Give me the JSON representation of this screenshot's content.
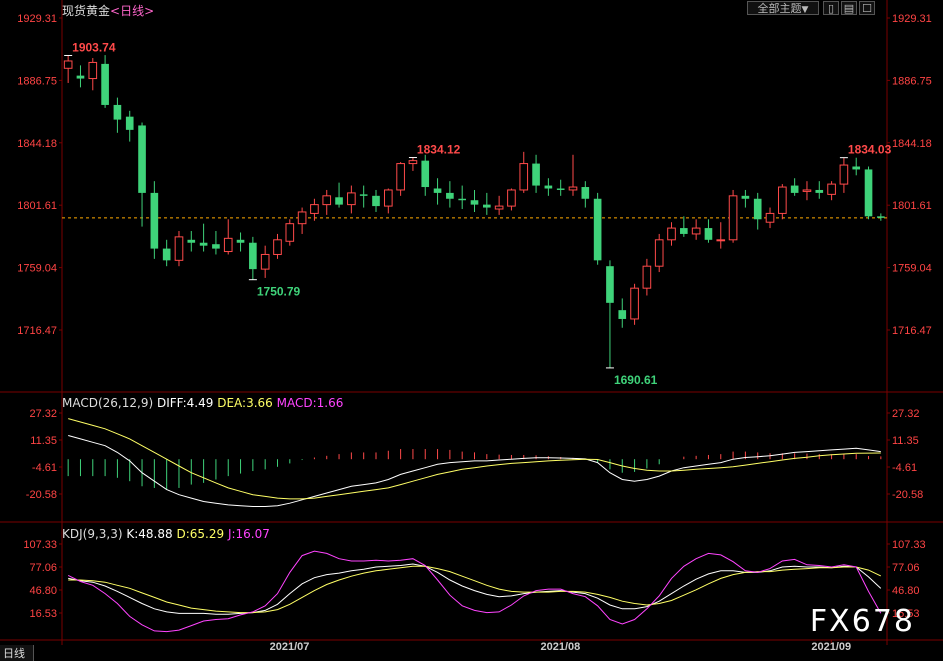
{
  "header": {
    "instrument": "现货黄金",
    "period_open": "<",
    "period": "日线",
    "period_close": ">"
  },
  "toolbar": {
    "theme_select": "全部主题",
    "theme_arrow": "▼",
    "btn1": "▯",
    "btn2": "▤",
    "btn3": "☐"
  },
  "macd": {
    "label": "MACD(26,12,9)",
    "diff": "DIFF:4.49",
    "dea": "DEA:3.66",
    "macd": "MACD:1.66"
  },
  "kdj": {
    "label": "KDJ(9,3,3)",
    "k": "K:48.88",
    "d": "D:65.29",
    "j": "J:16.07"
  },
  "bottom_tab": "日线",
  "watermark": "FX678",
  "colors": {
    "up": "#ff4a4a",
    "down": "#3fd37a",
    "diff": "#ffffff",
    "dea": "#ffff66",
    "macd_label": "#ff44ff",
    "j": "#ff44ff",
    "axis_text": "#ff4444",
    "grid": "#3a0000"
  },
  "chart_data": [
    {
      "type": "candlestick",
      "title": "现货黄金",
      "y_ticks": [
        "1929.31",
        "1886.75",
        "1844.18",
        "1801.61",
        "1759.04",
        "1716.47"
      ],
      "x_ticks": [
        "2021/07",
        "2021/08",
        "2021/09"
      ],
      "ylim": [
        1673.86,
        1929.31
      ],
      "current_price": 1793,
      "annotations": [
        {
          "text": "1903.74",
          "index": 0,
          "value": 1903.74
        },
        {
          "text": "1834.12",
          "index": 28,
          "value": 1834.12
        },
        {
          "text": "1750.79",
          "index": 15,
          "value": 1750.79
        },
        {
          "text": "1690.61",
          "index": 44,
          "value": 1690.61
        },
        {
          "text": "1834.03",
          "index": 63,
          "value": 1834.03
        }
      ],
      "ohlc": [
        [
          1895,
          1903.74,
          1885,
          1900
        ],
        [
          1890,
          1897,
          1882,
          1888
        ],
        [
          1888,
          1902,
          1880,
          1899
        ],
        [
          1898,
          1904,
          1868,
          1870
        ],
        [
          1870,
          1875,
          1851,
          1860
        ],
        [
          1862,
          1866,
          1845,
          1853
        ],
        [
          1856,
          1858,
          1787,
          1810
        ],
        [
          1810,
          1818,
          1765,
          1772
        ],
        [
          1772,
          1778,
          1760,
          1764
        ],
        [
          1764,
          1784,
          1760,
          1780
        ],
        [
          1778,
          1784,
          1770,
          1776
        ],
        [
          1776,
          1789,
          1770,
          1774
        ],
        [
          1775,
          1784,
          1768,
          1772
        ],
        [
          1770,
          1792,
          1768,
          1779
        ],
        [
          1778,
          1783,
          1770,
          1776
        ],
        [
          1776,
          1780,
          1750.79,
          1758
        ],
        [
          1758,
          1774,
          1752,
          1768
        ],
        [
          1768,
          1782,
          1765,
          1778
        ],
        [
          1777,
          1792,
          1774,
          1789
        ],
        [
          1789,
          1800,
          1782,
          1797
        ],
        [
          1796,
          1806,
          1791,
          1802
        ],
        [
          1802,
          1812,
          1795,
          1808
        ],
        [
          1807,
          1817,
          1800,
          1802
        ],
        [
          1802,
          1815,
          1796,
          1810
        ],
        [
          1809,
          1815,
          1800,
          1808
        ],
        [
          1808,
          1812,
          1797,
          1801
        ],
        [
          1801,
          1813,
          1796,
          1812
        ],
        [
          1812,
          1831,
          1808,
          1830
        ],
        [
          1830,
          1834.12,
          1825,
          1832
        ],
        [
          1832,
          1836,
          1808,
          1814
        ],
        [
          1813,
          1820,
          1802,
          1810
        ],
        [
          1810,
          1818,
          1800,
          1806
        ],
        [
          1806,
          1815,
          1799,
          1805
        ],
        [
          1805,
          1812,
          1797,
          1802
        ],
        [
          1802,
          1810,
          1795,
          1800
        ],
        [
          1799,
          1808,
          1795,
          1801
        ],
        [
          1801,
          1813,
          1798,
          1812
        ],
        [
          1812,
          1838,
          1810,
          1830
        ],
        [
          1830,
          1836,
          1810,
          1815
        ],
        [
          1815,
          1820,
          1808,
          1813
        ],
        [
          1813,
          1819,
          1808,
          1812
        ],
        [
          1812,
          1836,
          1808,
          1814
        ],
        [
          1814,
          1818,
          1800,
          1806
        ],
        [
          1806,
          1810,
          1761,
          1764
        ],
        [
          1760,
          1764,
          1690.61,
          1735
        ],
        [
          1730,
          1738,
          1718,
          1724
        ],
        [
          1724,
          1748,
          1720,
          1745
        ],
        [
          1745,
          1765,
          1740,
          1760
        ],
        [
          1760,
          1782,
          1756,
          1778
        ],
        [
          1778,
          1790,
          1774,
          1786
        ],
        [
          1786,
          1794,
          1780,
          1782
        ],
        [
          1782,
          1792,
          1778,
          1786
        ],
        [
          1786,
          1792,
          1776,
          1778
        ],
        [
          1778,
          1790,
          1772,
          1778
        ],
        [
          1778,
          1812,
          1776,
          1808
        ],
        [
          1808,
          1812,
          1800,
          1806
        ],
        [
          1806,
          1810,
          1785,
          1792
        ],
        [
          1790,
          1800,
          1786,
          1796
        ],
        [
          1796,
          1816,
          1792,
          1814
        ],
        [
          1815,
          1820,
          1808,
          1810
        ],
        [
          1811,
          1818,
          1805,
          1812
        ],
        [
          1812,
          1818,
          1806,
          1810
        ],
        [
          1809,
          1818,
          1805,
          1816
        ],
        [
          1816,
          1834.03,
          1810,
          1829
        ],
        [
          1828,
          1834,
          1822,
          1826
        ],
        [
          1826,
          1828,
          1792,
          1794
        ],
        [
          1794,
          1796,
          1791,
          1793
        ]
      ]
    },
    {
      "type": "line",
      "title": "MACD(26,12,9)",
      "y_ticks": [
        "27.32",
        "11.35",
        "-4.61",
        "-20.58"
      ],
      "ylim": [
        -36.55,
        35.3
      ],
      "series": [
        {
          "name": "DIFF",
          "values": [
            14,
            12,
            10,
            8,
            4,
            -1,
            -8,
            -13,
            -18,
            -21,
            -23,
            -25,
            -26,
            -27,
            -27.5,
            -28,
            -28,
            -27.5,
            -26,
            -24,
            -22,
            -20,
            -18,
            -16,
            -15,
            -14,
            -12,
            -9,
            -7,
            -5,
            -3,
            -2,
            -1.5,
            -1,
            -1,
            -0.5,
            0,
            0.5,
            0.8,
            0.8,
            0.7,
            0.5,
            0.2,
            -2,
            -8,
            -12,
            -13,
            -12,
            -10,
            -7,
            -5,
            -4,
            -3,
            -2,
            0,
            1,
            1.5,
            2,
            3,
            4,
            4.5,
            5,
            5.5,
            6,
            6.5,
            5.5,
            4.49
          ]
        },
        {
          "name": "DEA",
          "values": [
            24,
            22,
            20,
            18,
            15,
            12,
            8,
            4,
            0,
            -4,
            -8,
            -11,
            -14,
            -17,
            -19,
            -21,
            -22,
            -23,
            -23.5,
            -23.5,
            -23,
            -22,
            -21,
            -20,
            -19,
            -18,
            -17,
            -15,
            -13,
            -11,
            -9,
            -7.5,
            -6,
            -5,
            -4,
            -3.2,
            -2.5,
            -2,
            -1.5,
            -1,
            -0.6,
            -0.3,
            0,
            -0.2,
            -2,
            -4,
            -5.5,
            -6.5,
            -7,
            -7,
            -6.5,
            -6,
            -5.5,
            -5,
            -4.5,
            -3.5,
            -2.5,
            -1.5,
            -0.5,
            0.5,
            1.2,
            2,
            2.6,
            3.1,
            3.5,
            3.6,
            3.66
          ]
        },
        {
          "name": "MACD",
          "values": [
            -10,
            -10,
            -10,
            -10,
            -11,
            -13,
            -16,
            -17,
            -18,
            -17,
            -15,
            -14,
            -12,
            -10,
            -8.5,
            -7,
            -6,
            -4.5,
            -2.5,
            -0.5,
            1,
            2,
            3,
            4,
            4,
            4,
            5,
            6,
            6,
            6,
            6,
            5.5,
            4.5,
            4,
            3,
            2.7,
            2.5,
            2.5,
            2.3,
            1.8,
            1.3,
            0.8,
            0.2,
            -1.8,
            -6,
            -8,
            -7.5,
            -5.5,
            -3,
            0,
            1.5,
            2,
            2.5,
            3,
            4.5,
            4.5,
            4,
            3.5,
            3.5,
            3.5,
            3.3,
            3,
            2.9,
            2.9,
            3,
            1.9,
            1.66
          ]
        }
      ]
    },
    {
      "type": "line",
      "title": "KDJ(9,3,3)",
      "y_ticks": [
        "107.33",
        "77.06",
        "46.80",
        "16.53"
      ],
      "ylim": [
        -6.5,
        114.8
      ],
      "series": [
        {
          "name": "K",
          "values": [
            62,
            59,
            57,
            52,
            45,
            37,
            29,
            22,
            18,
            16,
            16,
            16,
            15,
            15,
            16,
            17,
            20,
            28,
            42,
            55,
            63,
            67,
            69,
            72,
            74,
            77,
            78,
            79,
            81,
            78,
            70,
            60,
            52,
            46,
            41,
            38,
            39,
            42,
            44,
            45,
            46,
            44,
            42,
            36,
            27,
            22,
            22,
            25,
            32,
            42,
            52,
            61,
            68,
            72,
            72,
            70,
            70,
            72,
            77,
            78,
            77,
            77,
            76,
            78,
            77,
            64,
            48.88
          ]
        },
        {
          "name": "D",
          "values": [
            60,
            60,
            59,
            57,
            53,
            49,
            43,
            37,
            31,
            27,
            23,
            21,
            19,
            18,
            17,
            17,
            18,
            21,
            28,
            37,
            46,
            54,
            60,
            65,
            69,
            72,
            74,
            76,
            78,
            78,
            75,
            71,
            65,
            59,
            53,
            48,
            45,
            44,
            44,
            44,
            45,
            45,
            44,
            41,
            37,
            32,
            29,
            27,
            29,
            33,
            40,
            47,
            55,
            62,
            67,
            70,
            71,
            71,
            73,
            74,
            75,
            76,
            76,
            77,
            77,
            73,
            65.29
          ]
        },
        {
          "name": "J",
          "values": [
            66,
            58,
            53,
            42,
            29,
            12,
            1,
            -7,
            -8,
            -6,
            0,
            6,
            8,
            9,
            14,
            18,
            26,
            42,
            70,
            92,
            98,
            95,
            88,
            85,
            85,
            86,
            85,
            86,
            88,
            79,
            60,
            40,
            26,
            20,
            17,
            18,
            27,
            39,
            46,
            48,
            48,
            42,
            38,
            26,
            8,
            2,
            8,
            22,
            39,
            62,
            78,
            88,
            95,
            93,
            84,
            72,
            70,
            75,
            85,
            87,
            80,
            79,
            77,
            80,
            77,
            45,
            16.07
          ]
        }
      ]
    }
  ]
}
